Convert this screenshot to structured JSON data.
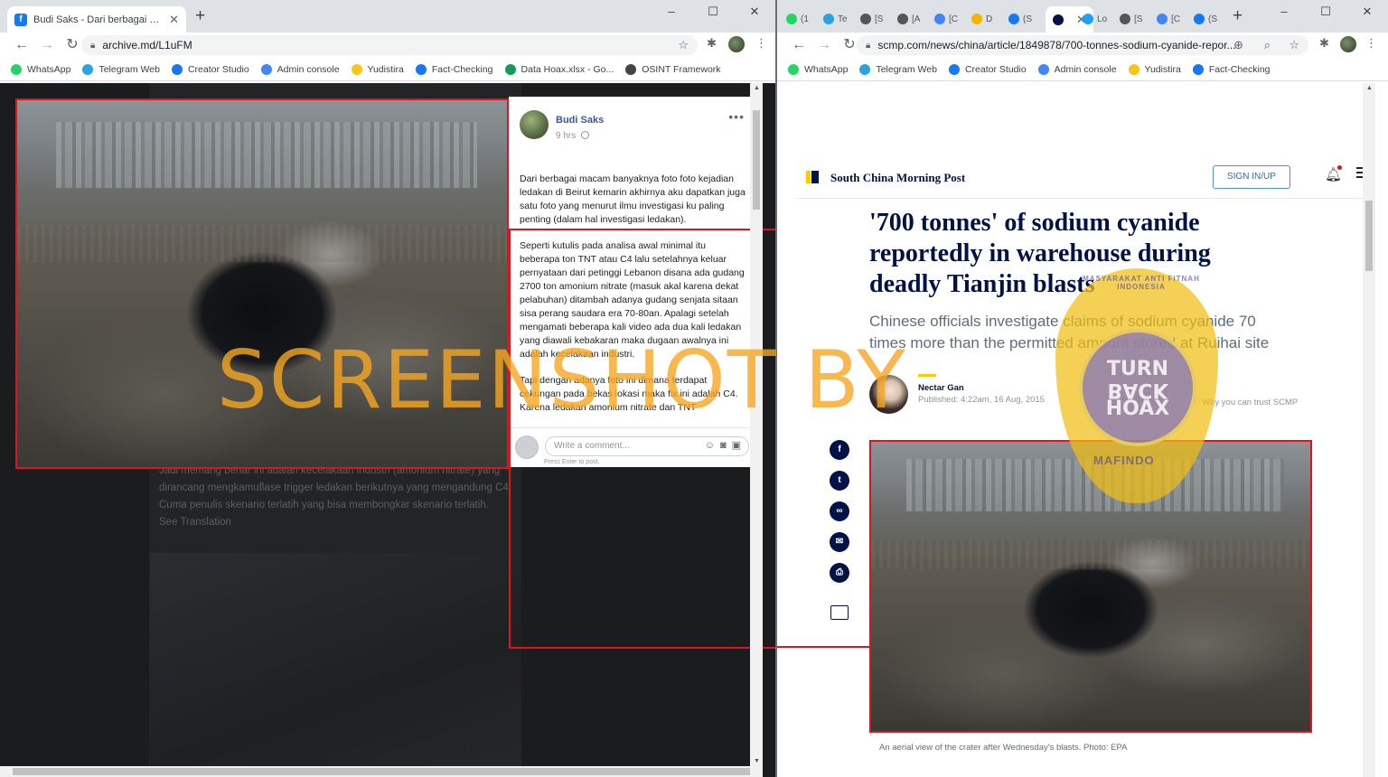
{
  "left_window": {
    "tab_title": "Budi Saks - Dari berbagai macam",
    "new_tab": "+",
    "window_controls": [
      "–",
      "☐",
      "✕"
    ],
    "url": "archive.md/L1uFM",
    "bookmarks": [
      {
        "label": "WhatsApp",
        "icon": "whatsapp-icon",
        "color": "#25d366"
      },
      {
        "label": "Telegram Web",
        "icon": "telegram-icon",
        "color": "#2aa3e0"
      },
      {
        "label": "Creator Studio",
        "icon": "facebook-icon",
        "color": "#1877f2"
      },
      {
        "label": "Admin console",
        "icon": "google-icon",
        "color": "#4285f4"
      },
      {
        "label": "Yudistira",
        "icon": "pikachu-icon",
        "color": "#f5c518"
      },
      {
        "label": "Fact-Checking",
        "icon": "facebook-icon",
        "color": "#1877f2"
      },
      {
        "label": "Data Hoax.xlsx - Go...",
        "icon": "sheets-icon",
        "color": "#0f9d58"
      },
      {
        "label": "OSINT Framework",
        "icon": "osint-icon",
        "color": "#444"
      }
    ],
    "post": {
      "author": "Budi Saks",
      "time": "9 hrs",
      "paragraphs": [
        "Dari berbagai macam banyaknya foto foto kejadian ledakan di Beirut kemarin akhirnya aku dapatkan juga satu foto yang menurut ilmu investigasi ku paling penting (dalam hal investigasi ledakan).",
        "Seperti kutulis pada analisa awal minimal itu beberapa ton TNT atau C4 lalu setelahnya keluar pernyataan dari petinggi Lebanon disana ada gudang 2700 ton amonium nitrate (masuk akal karena dekat pelabuhan) ditambah adanya gudang senjata sitaan sisa perang saudara era 70-80an. Apalagi setelah mengamati beberapa kali video ada dua kali ledakan yang diawali kebakaran maka dugaan awalnya ini adalah kecelakaan industri.",
        "Tapi dengan adanya foto ini dimana terdapat cekungan pada bekas lokasi maka fix ini adalah C4. Karena ledakan amonium nitrate dan TNT"
      ],
      "comment_placeholder": "Write a comment...",
      "comment_hint": "Press Enter to post."
    },
    "background_text": [
      "Jadi memang benar ini adalah kecelakaan industri (amonium nitrate) yang dirancang mengkamuflase trigger ledakan berikutnya yang mengandung C4.",
      "Cuma penulis skenario terlatih yang bisa membongkar skenario terlatih.",
      "See Translation"
    ]
  },
  "watermark": "SCREENSHOT BY",
  "right_window": {
    "tabs": [
      {
        "label": "(1",
        "color": "#25d366"
      },
      {
        "label": "Te",
        "color": "#2aa3e0"
      },
      {
        "label": "[S",
        "color": "#555"
      },
      {
        "label": "[A",
        "color": "#555"
      },
      {
        "label": "[C",
        "color": "#4285f4"
      },
      {
        "label": "D",
        "color": "#f4b400"
      },
      {
        "label": "(S",
        "color": "#1877f2"
      },
      {
        "label": "",
        "color": "#001246"
      },
      {
        "label": "Lo",
        "color": "#1da1f2"
      },
      {
        "label": "[S",
        "color": "#555"
      },
      {
        "label": "[C",
        "color": "#4285f4"
      },
      {
        "label": "(S",
        "color": "#1877f2"
      }
    ],
    "new_tab": "+",
    "window_controls": [
      "–",
      "☐",
      "✕"
    ],
    "url": "scmp.com/news/china/article/1849878/700-tonnes-sodium-cyanide-repor...",
    "bookmarks": [
      {
        "label": "WhatsApp",
        "icon": "whatsapp-icon",
        "color": "#25d366"
      },
      {
        "label": "Telegram Web",
        "icon": "telegram-icon",
        "color": "#2aa3e0"
      },
      {
        "label": "Creator Studio",
        "icon": "facebook-icon",
        "color": "#1877f2"
      },
      {
        "label": "Admin console",
        "icon": "google-icon",
        "color": "#4285f4"
      },
      {
        "label": "Yudistira",
        "icon": "pikachu-icon",
        "color": "#f5c518"
      },
      {
        "label": "Fact-Checking",
        "icon": "facebook-icon",
        "color": "#1877f2"
      }
    ],
    "site": {
      "logo": "South China Morning Post",
      "sign_in": "SIGN IN/UP",
      "headline": "'700 tonnes' of sodium cyanide reportedly in warehouse during deadly Tianjin blasts",
      "subhead": "Chinese officials investigate claims of sodium cyanide 70 times more than the permitted amount stored at Ruihai site",
      "author": "Nectar Gan",
      "published": "Published: 4:22am, 16 Aug, 2015",
      "trust": "Why you can trust SCMP",
      "share_buttons": [
        {
          "name": "facebook-share-icon",
          "glyph": "f"
        },
        {
          "name": "twitter-share-icon",
          "glyph": "t"
        },
        {
          "name": "link-share-icon",
          "glyph": "∞"
        },
        {
          "name": "email-share-icon",
          "glyph": "✉"
        },
        {
          "name": "print-share-icon",
          "glyph": "⎙"
        }
      ],
      "caption": "An aerial view of the crater after Wednesday's blasts. Photo: EPA"
    }
  },
  "badge": {
    "line1": "TURN",
    "line2": "BACK",
    "line3": "HOAX",
    "ring_top": "MASYARAKAT ANTI FITNAH INDONESIA",
    "ring_bottom": "MAFINDO"
  }
}
